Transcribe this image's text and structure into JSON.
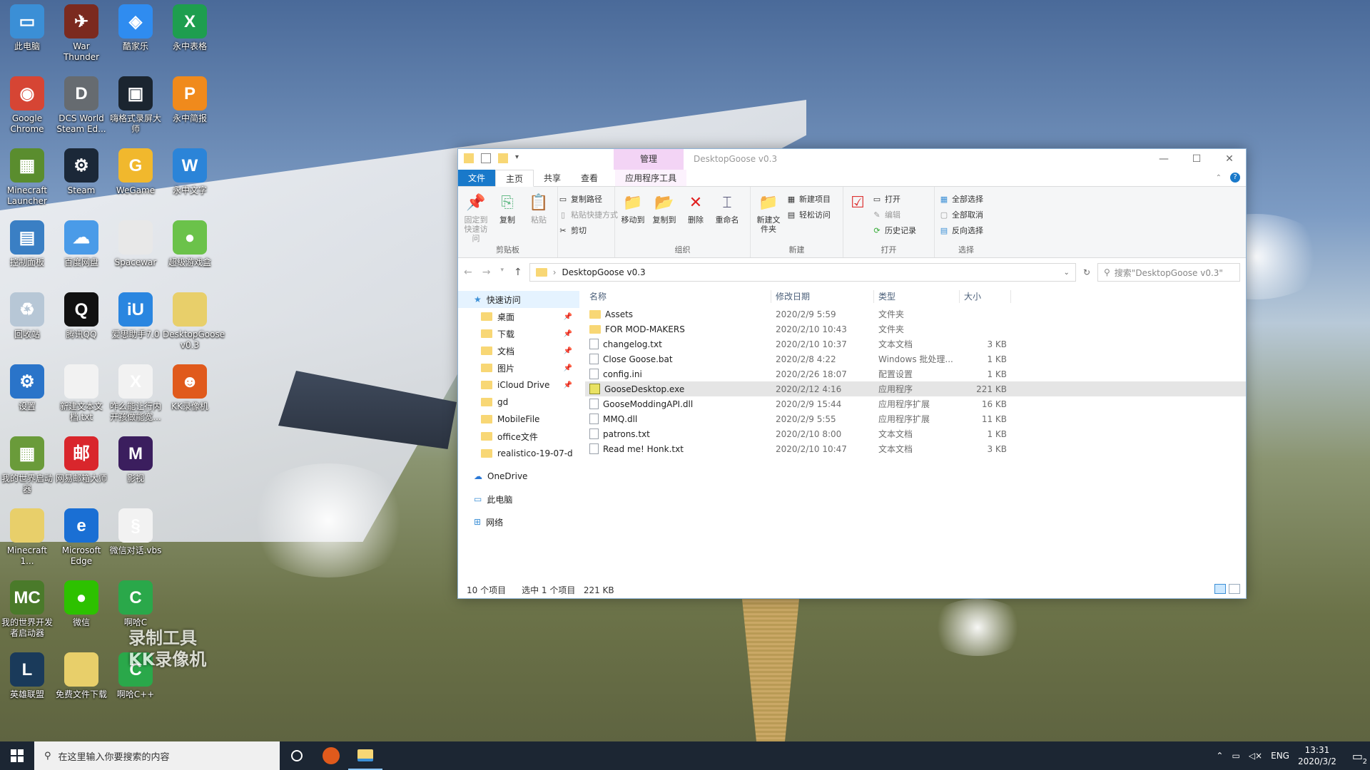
{
  "desktop": {
    "icons": [
      {
        "label": "此电脑",
        "color": "#3b8fd6",
        "glyph": "▭"
      },
      {
        "label": "War Thunder",
        "color": "#7b2a1f",
        "glyph": "✈"
      },
      {
        "label": "酷家乐",
        "color": "#2f8cf0",
        "glyph": "◈"
      },
      {
        "label": "永中表格",
        "color": "#1e9e4f",
        "glyph": "X"
      },
      {
        "label": "Google Chrome",
        "color": "#d64534",
        "glyph": "◉"
      },
      {
        "label": "DCS World Steam Ed...",
        "color": "#666b70",
        "glyph": "D"
      },
      {
        "label": "嗨格式录屏大师",
        "color": "#1b2530",
        "glyph": "▣"
      },
      {
        "label": "永中简报",
        "color": "#f08a1c",
        "glyph": "P"
      },
      {
        "label": "Minecraft Launcher",
        "color": "#5a8d2e",
        "glyph": "▦"
      },
      {
        "label": "Steam",
        "color": "#1b2838",
        "glyph": "⚙"
      },
      {
        "label": "WeGame",
        "color": "#f1b82d",
        "glyph": "G"
      },
      {
        "label": "永中文字",
        "color": "#2b84d8",
        "glyph": "W"
      },
      {
        "label": "控制面板",
        "color": "#3a7fc4",
        "glyph": "▤"
      },
      {
        "label": "百度网盘",
        "color": "#4a9be8",
        "glyph": "☁"
      },
      {
        "label": "Spacewar",
        "color": "#e8e8e8",
        "glyph": " "
      },
      {
        "label": "超级游戏盒",
        "color": "#6bc24a",
        "glyph": "●"
      },
      {
        "label": "回收站",
        "color": "#b7c7d6",
        "glyph": "♻"
      },
      {
        "label": "腾讯QQ",
        "color": "#111111",
        "glyph": "Q"
      },
      {
        "label": "爱思助手7.0",
        "color": "#2a86e0",
        "glyph": "iU"
      },
      {
        "label": "DesktopGoose v0.3",
        "color": "#e8cf6a",
        "glyph": " "
      },
      {
        "label": "设置",
        "color": "#2a74c9",
        "glyph": "⚙"
      },
      {
        "label": "新建文本文档.txt",
        "color": "#f2f2f2",
        "glyph": " "
      },
      {
        "label": "咋么能让行内开孩做能宽...",
        "color": "#f2f2f2",
        "glyph": "X"
      },
      {
        "label": "KK录像机",
        "color": "#e05a1c",
        "glyph": "☻"
      },
      {
        "label": "我的世界启动器",
        "color": "#6a9b3a",
        "glyph": "▦"
      },
      {
        "label": "网易邮箱大师",
        "color": "#d9262c",
        "glyph": "邮"
      },
      {
        "label": "影视",
        "color": "#3b1e5e",
        "glyph": "M"
      },
      {
        "label": "",
        "color": "transparent",
        "glyph": " "
      },
      {
        "label": "Minecraft 1...",
        "color": "#e8cf6a",
        "glyph": " "
      },
      {
        "label": "Microsoft Edge",
        "color": "#1a6fd4",
        "glyph": "e"
      },
      {
        "label": "微信对话.vbs",
        "color": "#f2f2f2",
        "glyph": "§"
      },
      {
        "label": "",
        "color": "transparent",
        "glyph": " "
      },
      {
        "label": "我的世界开发者启动器",
        "color": "#4a7a2a",
        "glyph": "MC"
      },
      {
        "label": "微信",
        "color": "#2dc100",
        "glyph": "●"
      },
      {
        "label": "啊哈C",
        "color": "#2aa84a",
        "glyph": "C"
      },
      {
        "label": "",
        "color": "transparent",
        "glyph": " "
      },
      {
        "label": "英雄联盟",
        "color": "#1a3a5a",
        "glyph": "L"
      },
      {
        "label": "免费文件下载",
        "color": "#e8cf6a",
        "glyph": " "
      },
      {
        "label": "啊哈C++",
        "color": "#2aa84a",
        "glyph": "C"
      }
    ],
    "watermark_line1": "录制工具",
    "watermark_line2": "KK录像机"
  },
  "explorer": {
    "quick_access_title": "DesktopGoose v0.3",
    "manage_tab": "管理",
    "window_title": "DesktopGoose v0.3",
    "tabs": {
      "file": "文件",
      "home": "主页",
      "share": "共享",
      "view": "查看",
      "app_tools": "应用程序工具"
    },
    "ribbon": {
      "clipboard": {
        "pin_quick": "固定到快速访问",
        "copy": "复制",
        "paste": "粘贴",
        "copy_path": "复制路径",
        "paste_shortcut": "粘贴快捷方式",
        "cut": "剪切",
        "label": "剪贴板"
      },
      "organize": {
        "move_to": "移动到",
        "copy_to": "复制到",
        "delete": "删除",
        "rename": "重命名",
        "label": "组织"
      },
      "new": {
        "new_folder": "新建文件夹",
        "new_item": "新建项目",
        "easy_access": "轻松访问",
        "label": "新建"
      },
      "open": {
        "properties": "属性",
        "open": "打开",
        "edit": "编辑",
        "history": "历史记录",
        "label": "打开"
      },
      "select": {
        "select_all": "全部选择",
        "select_none": "全部取消",
        "invert": "反向选择",
        "label": "选择"
      }
    },
    "address": {
      "path": "DesktopGoose v0.3",
      "search_placeholder": "搜索\"DesktopGoose v0.3\""
    },
    "nav": {
      "quick_access": "快速访问",
      "items": [
        {
          "label": "桌面",
          "pinned": true
        },
        {
          "label": "下载",
          "pinned": true
        },
        {
          "label": "文档",
          "pinned": true
        },
        {
          "label": "图片",
          "pinned": true
        },
        {
          "label": "iCloud Drive",
          "pinned": true
        },
        {
          "label": "gd",
          "pinned": false
        },
        {
          "label": "MobileFile",
          "pinned": false
        },
        {
          "label": "office文件",
          "pinned": false
        },
        {
          "label": "realistico-19-07-d",
          "pinned": false
        }
      ],
      "onedrive": "OneDrive",
      "this_pc": "此电脑",
      "network": "网络"
    },
    "columns": {
      "name": "名称",
      "date": "修改日期",
      "type": "类型",
      "size": "大小"
    },
    "files": [
      {
        "name": "Assets",
        "date": "2020/2/9 5:59",
        "type": "文件夹",
        "size": "",
        "kind": "folder"
      },
      {
        "name": "FOR MOD-MAKERS",
        "date": "2020/2/10 10:43",
        "type": "文件夹",
        "size": "",
        "kind": "folder"
      },
      {
        "name": "changelog.txt",
        "date": "2020/2/10 10:37",
        "type": "文本文档",
        "size": "3 KB",
        "kind": "file"
      },
      {
        "name": "Close Goose.bat",
        "date": "2020/2/8 4:22",
        "type": "Windows 批处理...",
        "size": "1 KB",
        "kind": "file"
      },
      {
        "name": "config.ini",
        "date": "2020/2/26 18:07",
        "type": "配置设置",
        "size": "1 KB",
        "kind": "file"
      },
      {
        "name": "GooseDesktop.exe",
        "date": "2020/2/12 4:16",
        "type": "应用程序",
        "size": "221 KB",
        "kind": "exe"
      },
      {
        "name": "GooseModdingAPI.dll",
        "date": "2020/2/9 15:44",
        "type": "应用程序扩展",
        "size": "16 KB",
        "kind": "file"
      },
      {
        "name": "MMQ.dll",
        "date": "2020/2/9 5:55",
        "type": "应用程序扩展",
        "size": "11 KB",
        "kind": "file"
      },
      {
        "name": "patrons.txt",
        "date": "2020/2/10 8:00",
        "type": "文本文档",
        "size": "1 KB",
        "kind": "file"
      },
      {
        "name": "Read me! Honk.txt",
        "date": "2020/2/10 10:47",
        "type": "文本文档",
        "size": "3 KB",
        "kind": "file"
      }
    ],
    "status": {
      "count": "10 个项目",
      "selected": "选中 1 个项目",
      "size": "221 KB"
    }
  },
  "taskbar": {
    "search_placeholder": "在这里输入你要搜索的内容",
    "lang": "ENG",
    "time": "13:31",
    "date": "2020/3/2",
    "notifications": "2"
  }
}
